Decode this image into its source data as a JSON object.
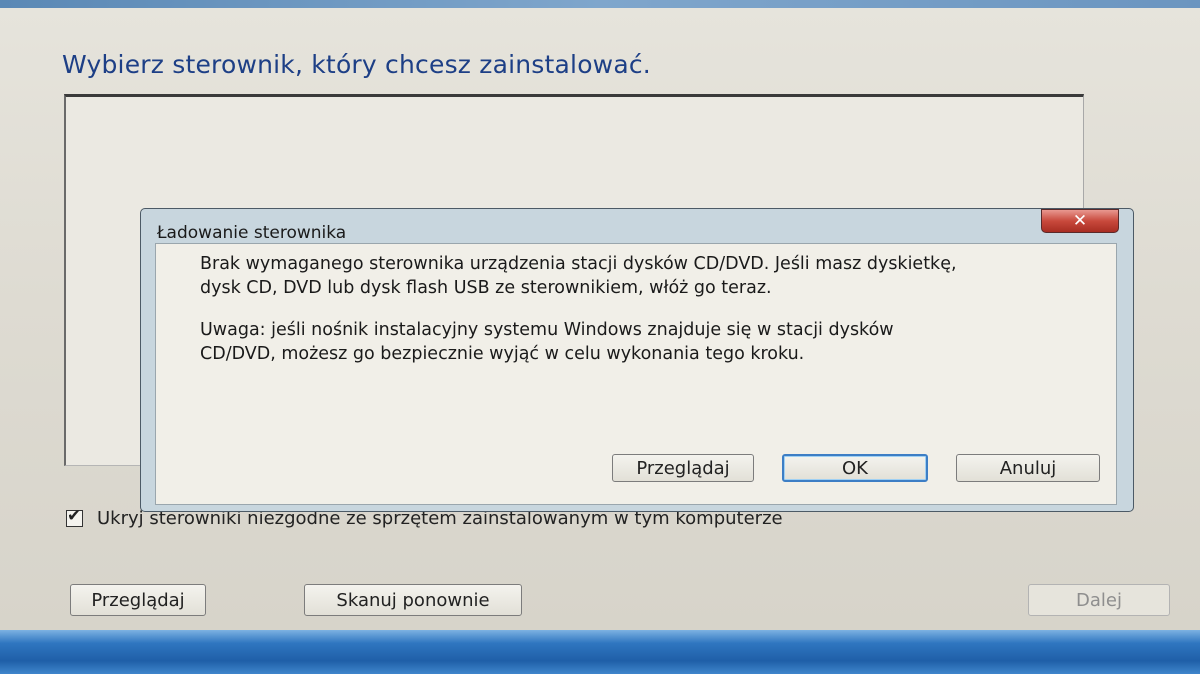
{
  "window": {
    "title": "Wybierz sterownik, który chcesz zainstalować.",
    "hide_incompatible": {
      "checked": true,
      "check_glyph": "✔",
      "label": "Ukryj sterowniki niezgodne ze sprzętem zainstalowanym w tym komputerze"
    },
    "buttons": {
      "browse": "Przeglądaj",
      "rescan": "Skanuj ponownie",
      "next": "Dalej"
    }
  },
  "dialog": {
    "title": "Ładowanie sterownika",
    "close_glyph": "✕",
    "message": [
      "Brak wymaganego sterownika urządzenia stacji dysków CD/DVD. Jeśli masz dyskietkę,",
      "dysk CD, DVD lub dysk flash USB ze sterownikiem, włóż go teraz.",
      "Uwaga: jeśli nośnik instalacyjny systemu Windows znajduje się w stacji dysków",
      "CD/DVD, możesz go bezpiecznie wyjąć w celu wykonania tego kroku."
    ],
    "buttons": {
      "browse": "Przeglądaj",
      "ok": "OK",
      "cancel": "Anuluj"
    }
  },
  "colors": {
    "title_blue": "#1d3f86",
    "close_red": "#c8493c",
    "focus_blue": "#3d7ec5",
    "taskbar_blue": "#2f76c0"
  },
  "icons": [
    "checkbox-check-icon",
    "close-icon"
  ]
}
